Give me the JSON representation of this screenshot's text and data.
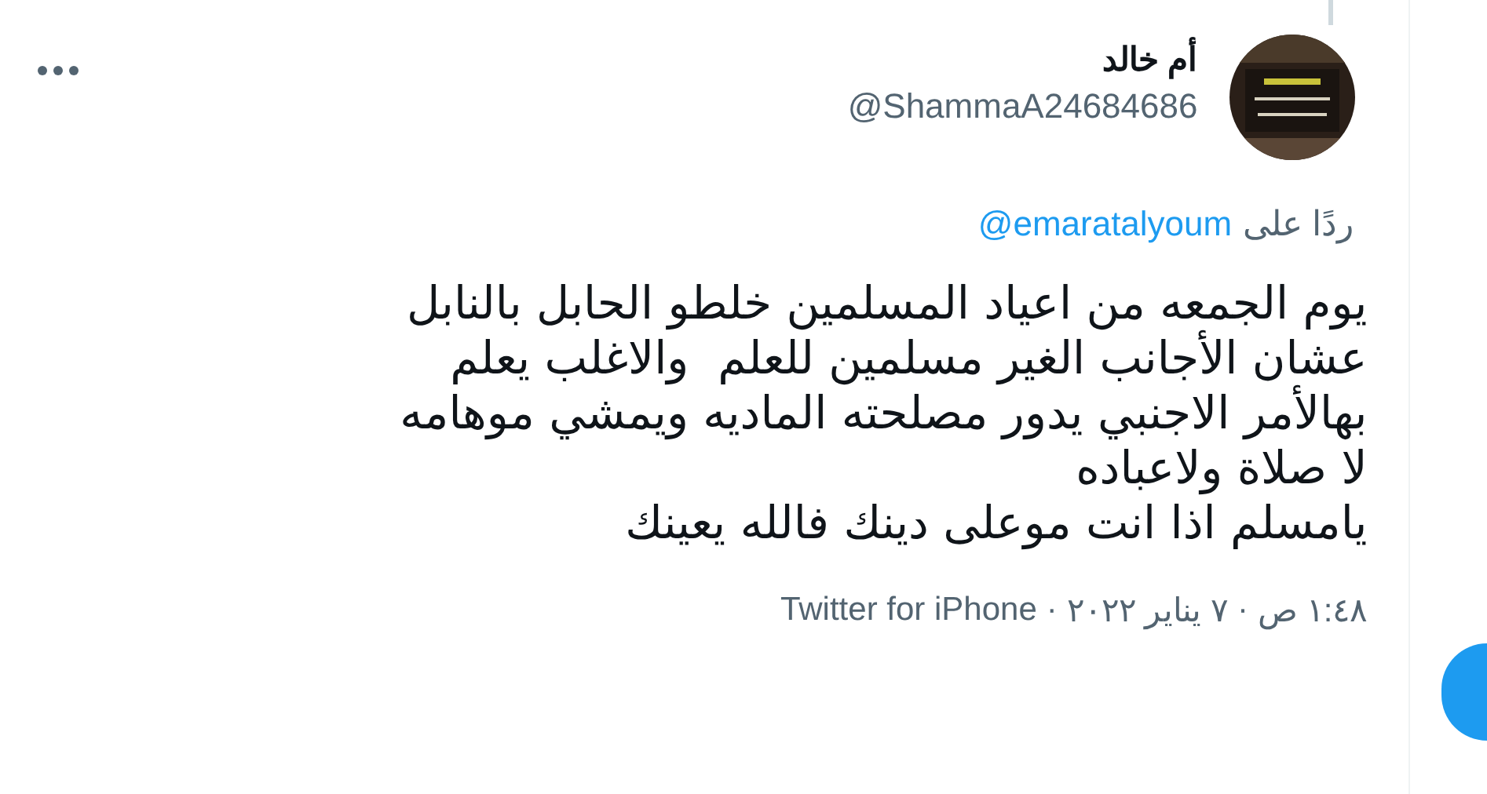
{
  "tweet": {
    "author": {
      "name": "أم خالد",
      "handle": "@ShammaA24684686"
    },
    "reply_to": {
      "prefix": "ردًا على",
      "mention": "@emaratalyoum"
    },
    "text_lines": [
      "يوم الجمعه من اعياد المسلمين خلطو الحابل بالنابل",
      "عشان الأجانب الغير مسلمين للعلم  والاغلب يعلم",
      "بهالأمر الاجنبي يدور مصلحته الماديه ويمشي موهامه",
      "لا صلاة ولاعباده",
      "يامسلم اذا انت موعلى دينك فالله يعينك"
    ],
    "time": "١:٤٨ ص",
    "date": "٧ يناير ٢٠٢٢",
    "separator": "·",
    "source": "Twitter for iPhone"
  }
}
